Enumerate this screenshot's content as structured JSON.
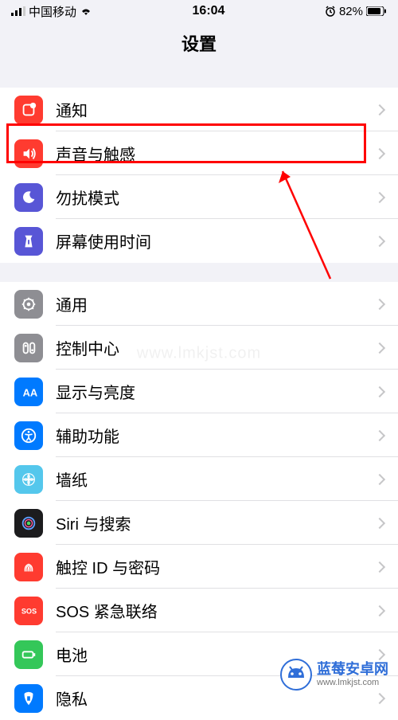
{
  "status_bar": {
    "carrier": "中国移动",
    "time": "16:04",
    "battery_percent": "82%"
  },
  "header": {
    "title": "设置"
  },
  "section1": {
    "items": [
      {
        "label": "通知",
        "icon": "notifications",
        "color": "#ff3b30"
      },
      {
        "label": "声音与触感",
        "icon": "sounds",
        "color": "#ff3b30",
        "highlighted": true
      },
      {
        "label": "勿扰模式",
        "icon": "dnd",
        "color": "#5856d6"
      },
      {
        "label": "屏幕使用时间",
        "icon": "screentime",
        "color": "#5856d6"
      }
    ]
  },
  "section2": {
    "items": [
      {
        "label": "通用",
        "icon": "general",
        "color": "#8e8e93"
      },
      {
        "label": "控制中心",
        "icon": "control-center",
        "color": "#8e8e93"
      },
      {
        "label": "显示与亮度",
        "icon": "display",
        "color": "#007aff"
      },
      {
        "label": "辅助功能",
        "icon": "accessibility",
        "color": "#007aff"
      },
      {
        "label": "墙纸",
        "icon": "wallpaper",
        "color": "#54c7ec"
      },
      {
        "label": "Siri 与搜索",
        "icon": "siri",
        "color": "#222"
      },
      {
        "label": "触控 ID 与密码",
        "icon": "touchid",
        "color": "#ff3b30"
      },
      {
        "label": "SOS 紧急联络",
        "icon": "sos",
        "color": "#ff3b30"
      },
      {
        "label": "电池",
        "icon": "battery",
        "color": "#34c759"
      },
      {
        "label": "隐私",
        "icon": "privacy",
        "color": "#007aff"
      }
    ]
  },
  "watermark": {
    "title": "蓝莓安卓网",
    "url": "www.lmkjst.com",
    "center": "www.lmkjst.com"
  }
}
